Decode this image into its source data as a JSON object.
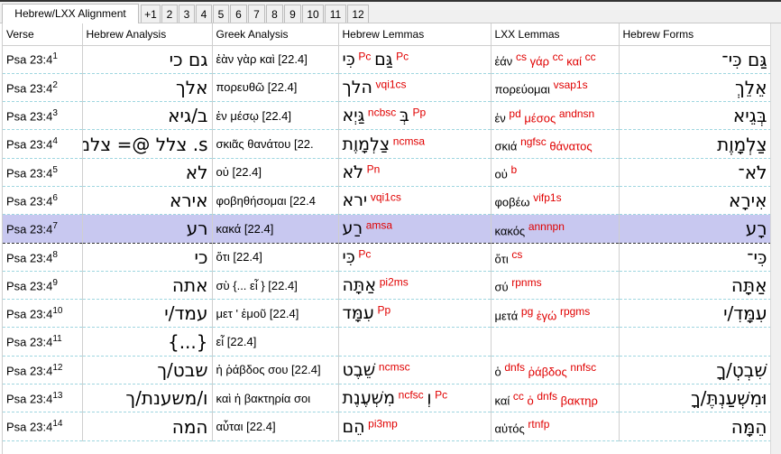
{
  "tabs": [
    "Hebrew/LXX Alignment",
    "+1",
    "2",
    "3",
    "4",
    "5",
    "6",
    "7",
    "8",
    "9",
    "10",
    "11",
    "12"
  ],
  "columns": [
    "Verse",
    "Hebrew Analysis",
    "Greek Analysis",
    "Hebrew Lemmas",
    "LXX Lemmas",
    "Hebrew Forms"
  ],
  "rows": [
    {
      "verse": "Psa 23:4",
      "n": "1",
      "heb": "גם כי",
      "greek": "ἐὰν γὰρ καὶ [22.4]",
      "hlem": "כִּי",
      "hlem_tag": "Pc",
      "hlem2": "גַּם",
      "hlem2_tag": "Pc",
      "lxx": "ἐάν",
      "lxx_tag": "cs",
      "lxx2": "γάρ",
      "lxx2_tag": "cc",
      "lxx3": "καί",
      "lxx3_tag": "cc",
      "form": "גַּם כִּי־"
    },
    {
      "verse": "Psa 23:4",
      "n": "2",
      "heb": "אלך",
      "greek": "πορευθῶ [22.4]",
      "hlem": "הלך",
      "hlem_tag": "vqi1cs",
      "lxx": "πορεύομαι",
      "lxx_tag": "vsap1s",
      "form": "אֵלֵךְ"
    },
    {
      "verse": "Psa 23:4",
      "n": "3",
      "heb": "ב/גיא",
      "greek": "ἐν μέσῳ [22.4]",
      "hlem": "גַּיְא",
      "hlem_tag": "ncbsc",
      "hlem2": "בְּ",
      "hlem2_tag": "Pp",
      "lxx": "ἐν",
      "lxx_tag": "pd",
      "lxx2": "μέσος",
      "lxx2_tag": "andnsn",
      "form": "בְּגֵיא"
    },
    {
      "verse": "Psa 23:4",
      "n": "4",
      "heb": "s. צלל @= צלמוור",
      "greek": "σκιᾶς θανάτου [22.",
      "hlem": "צַלְמָוֶת",
      "hlem_tag": "ncmsa",
      "lxx": "σκιά",
      "lxx_tag": "ngfsc",
      "lxx2": "θάνατος",
      "lxx2_tag": "",
      "form": "צַלְמָוֶת"
    },
    {
      "verse": "Psa 23:4",
      "n": "5",
      "heb": "לא",
      "greek": "οὐ [22.4]",
      "hlem": "לֹא",
      "hlem_tag": "Pn",
      "lxx": "οὐ",
      "lxx_tag": "b",
      "form": "לֹא־"
    },
    {
      "verse": "Psa 23:4",
      "n": "6",
      "heb": "אירא",
      "greek": "φοβηθήσομαι [22.4",
      "hlem": "ירא",
      "hlem_tag": "vqi1cs",
      "lxx": "φοβέω",
      "lxx_tag": "vifp1s",
      "form": "אִירָא"
    },
    {
      "verse": "Psa 23:4",
      "n": "7",
      "heb": "רע",
      "greek": "κακά [22.4]",
      "hlem": "רַע",
      "hlem_tag": "amsa",
      "lxx": "κακός",
      "lxx_tag": "annnpn",
      "form": "רָע"
    },
    {
      "verse": "Psa 23:4",
      "n": "8",
      "heb": "כי",
      "greek": "ὅτι [22.4]",
      "hlem": "כִּי",
      "hlem_tag": "Pc",
      "lxx": "ὅτι",
      "lxx_tag": "cs",
      "form": "כִּי־"
    },
    {
      "verse": "Psa 23:4",
      "n": "9",
      "heb": "אתה",
      "greek": "σὺ {... εἶ } [22.4]",
      "hlem": "אַתָּה",
      "hlem_tag": "pi2ms",
      "lxx": "σύ",
      "lxx_tag": "rpnms",
      "form": "אַתָּה"
    },
    {
      "verse": "Psa 23:4",
      "n": "10",
      "heb": "עמד/י",
      "greek": "μετ ' ἐμοῦ [22.4]",
      "hlem": "עִמָּד",
      "hlem_tag": "Pp",
      "lxx": "μετά",
      "lxx_tag": "pg",
      "lxx2": "ἐγώ",
      "lxx2_tag": "rpgms",
      "form": "עִמָּדִ/י"
    },
    {
      "verse": "Psa 23:4",
      "n": "11",
      "heb": "{...}",
      "greek": "εἶ [22.4]",
      "hlem": "",
      "hlem_tag": "",
      "lxx": "",
      "lxx_tag": "",
      "form": ""
    },
    {
      "verse": "Psa 23:4",
      "n": "12",
      "heb": "שבט/ך",
      "greek": "ἡ ῥάβδος σου [22.4]",
      "hlem": "שֵׁבֶט",
      "hlem_tag": "ncmsc",
      "lxx": "ὁ",
      "lxx_tag": "dnfs",
      "lxx2": "ῥάβδος",
      "lxx2_tag": "nnfsc",
      "form": "שִׁבְטְ/ךָ"
    },
    {
      "verse": "Psa 23:4",
      "n": "13",
      "heb": "ו/משענת/ך",
      "greek": "καὶ ἡ βακτηρία σοι",
      "hlem": "מִשְׁעֶנֶת",
      "hlem_tag": "ncfsc",
      "hlem2": "וְ",
      "hlem2_tag": "Pc",
      "lxx": "καί",
      "lxx_tag": "cc",
      "lxx2": "ὁ",
      "lxx2_tag": "dnfs",
      "lxx3": "βακτηρ",
      "lxx3_tag": "",
      "form": "וּמִשְׁעַנְתֶּ/ךָ"
    },
    {
      "verse": "Psa 23:4",
      "n": "14",
      "heb": "המה",
      "greek": "αὗται [22.4]",
      "hlem": "הֵם",
      "hlem_tag": "pi3mp",
      "lxx": "αὐτός",
      "lxx_tag": "rtnfp",
      "form": "הֵמָּה"
    }
  ],
  "selected_row": 6,
  "colors": {
    "selection": "#c8c8f0",
    "tag": "#e00000",
    "grid": "#9fd6e0"
  }
}
